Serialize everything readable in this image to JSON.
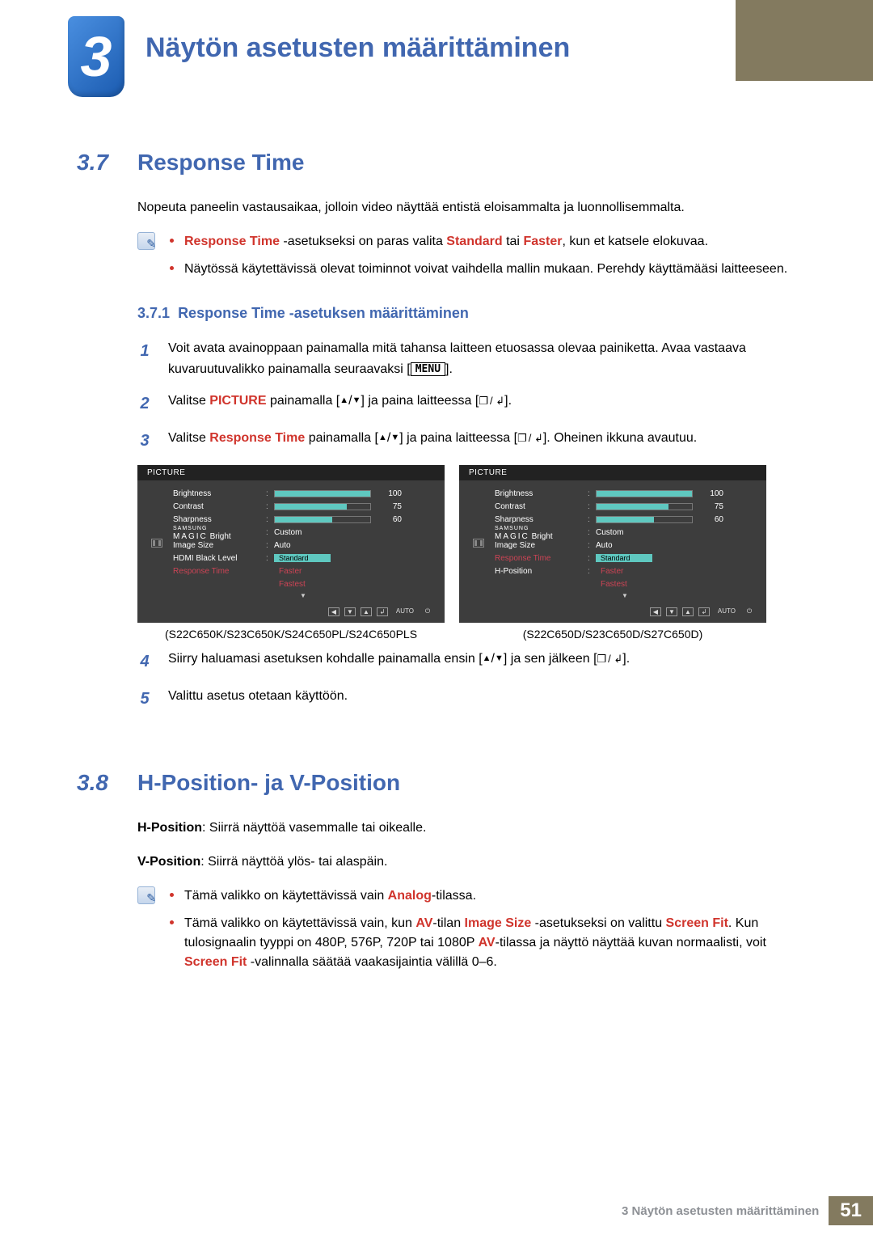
{
  "chapter": {
    "num": "3",
    "title": "Näytön asetusten määrittäminen"
  },
  "footer": {
    "label": "3 Näytön asetusten määrittäminen",
    "page": "51"
  },
  "s37": {
    "num": "3.7",
    "title": "Response Time",
    "intro": "Nopeuta paneelin vastausaikaa, jolloin video näyttää entistä eloisammalta ja luonnollisemmalta.",
    "note1_a": "Response Time",
    "note1_b": " -asetukseksi on paras valita ",
    "note1_c": "Standard",
    "note1_d": " tai ",
    "note1_e": "Faster",
    "note1_f": ", kun et katsele elokuvaa.",
    "note2": "Näytössä käytettävissä olevat toiminnot voivat vaihdella mallin mukaan. Perehdy käyttämääsi laitteeseen.",
    "sub_num": "3.7.1",
    "sub_title": "Response Time -asetuksen määrittäminen",
    "step1_a": "Voit avata avainoppaan painamalla mitä tahansa laitteen etuosassa olevaa painiketta. Avaa vastaava kuvaruutuvalikko painamalla seuraavaksi [",
    "step1_key": "MENU",
    "step1_b": "].",
    "step2_a": "Valitse ",
    "step2_b": "PICTURE",
    "step2_c": " painamalla [",
    "step2_d": "] ja paina laitteessa [",
    "step2_e": "].",
    "step3_a": "Valitse ",
    "step3_b": "Response Time",
    "step3_c": " painamalla [",
    "step3_d": "] ja paina laitteessa [",
    "step3_e": "]. Oheinen ikkuna avautuu.",
    "step4_a": "Siirry haluamasi asetuksen kohdalle painamalla ensin [",
    "step4_b": "] ja sen jälkeen [",
    "step4_c": "].",
    "step5": "Valittu asetus otetaan käyttöön.",
    "cap1": "(S22C650K/S23C650K/S24C650PL/S24C650PLS",
    "cap2": "(S22C650D/S23C650D/S27C650D)"
  },
  "osd": {
    "title": "PICTURE",
    "brightness": "Brightness",
    "brightness_v": "100",
    "contrast": "Contrast",
    "contrast_v": "75",
    "sharpness": "Sharpness",
    "sharpness_v": "60",
    "magic": "Bright",
    "magic_v": "Custom",
    "imgsize": "Image Size",
    "imgsize_v": "Auto",
    "hdmibl": "HDMI Black Level",
    "rt": "Response Time",
    "hpos": "H-Position",
    "opt_std": "Standard",
    "opt_fast": "Faster",
    "opt_fastest": "Fastest",
    "auto": "AUTO"
  },
  "s38": {
    "num": "3.8",
    "title": "H-Position- ja V-Position",
    "hpos_lbl": "H-Position",
    "hpos_txt": ": Siirrä näyttöä vasemmalle tai oikealle.",
    "vpos_lbl": "V-Position",
    "vpos_txt": ": Siirrä näyttöä ylös- tai alaspäin.",
    "n1_a": "Tämä valikko on käytettävissä vain ",
    "n1_b": "Analog",
    "n1_c": "-tilassa.",
    "n2_a": "Tämä valikko on käytettävissä vain, kun ",
    "n2_b": "AV",
    "n2_c": "-tilan ",
    "n2_d": "Image Size",
    "n2_e": " -asetukseksi on valittu ",
    "n2_f": "Screen Fit",
    "n2_g": ". Kun tulosignaalin tyyppi on 480P, 576P, 720P tai 1080P ",
    "n2_h": "AV",
    "n2_i": "-tilassa ja näyttö näyttää kuvan normaalisti, voit ",
    "n2_j": "Screen Fit",
    "n2_k": " -valinnalla säätää vaakasijaintia välillä 0–6."
  }
}
